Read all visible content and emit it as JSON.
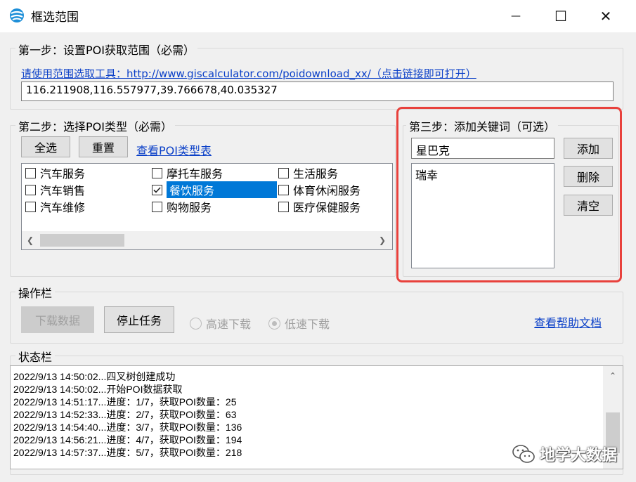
{
  "window": {
    "title": "框选范围",
    "minimize_glyph": "—",
    "maximize_glyph": "☐",
    "close_glyph": "✕",
    "app_icon": "globe-app-icon"
  },
  "step1": {
    "label": "第一步：设置POI获取范围（必需）",
    "link_text": "请使用范围选取工具：http://www.giscalculator.com/poidownload_xx/（点击链接即可打开）",
    "bounds_value": "116.211908,116.557977,39.766678,40.035327"
  },
  "step2": {
    "label": "第二步：选择POI类型（必需）",
    "select_all": "全选",
    "reset": "重置",
    "view_types_link": "查看POI类型表",
    "poi_types": [
      {
        "label": "汽车服务",
        "checked": false,
        "selected": false
      },
      {
        "label": "汽车销售",
        "checked": false,
        "selected": false
      },
      {
        "label": "汽车维修",
        "checked": false,
        "selected": false
      },
      {
        "label": "摩托车服务",
        "checked": false,
        "selected": false
      },
      {
        "label": "餐饮服务",
        "checked": true,
        "selected": true
      },
      {
        "label": "购物服务",
        "checked": false,
        "selected": false
      },
      {
        "label": "生活服务",
        "checked": false,
        "selected": false
      },
      {
        "label": "体育休闲服务",
        "checked": false,
        "selected": false
      },
      {
        "label": "医疗保健服务",
        "checked": false,
        "selected": false
      }
    ]
  },
  "step3": {
    "label": "第三步：添加关键词（可选）",
    "keyword_input_value": "星巴克",
    "keywords": [
      "瑞幸"
    ],
    "add": "添加",
    "delete": "删除",
    "clear": "清空",
    "highlight_color": "#e8413c"
  },
  "operations": {
    "label": "操作栏",
    "download": "下载数据",
    "stop": "停止任务",
    "fast_download": "高速下载",
    "slow_download": "低速下载",
    "slow_selected": true,
    "help_link": "查看帮助文档"
  },
  "status": {
    "label": "状态栏",
    "log": [
      "2022/9/13 14:50:02...四叉树创建成功",
      "2022/9/13 14:50:02...开始POI数据获取",
      "2022/9/13 14:51:17...进度：1/7，获取POI数量：25",
      "2022/9/13 14:52:33...进度：2/7，获取POI数量：63",
      "2022/9/13 14:54:40...进度：3/7，获取POI数量：136",
      "2022/9/13 14:56:21...进度：4/7，获取POI数量：194",
      "2022/9/13 14:57:37...进度：5/7，获取POI数量：218"
    ]
  },
  "watermark": "地学大数据"
}
